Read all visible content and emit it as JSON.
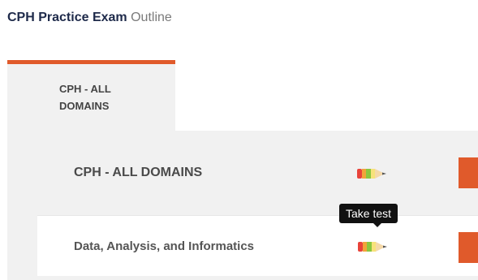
{
  "header": {
    "title_strong": "CPH Practice Exam",
    "title_light": "Outline"
  },
  "tabs": [
    {
      "label": "CPH - ALL DOMAINS",
      "active": true
    }
  ],
  "sections": [
    {
      "label": "CPH - ALL DOMAINS",
      "action_icon": "pencil-icon",
      "items": [
        {
          "label": "Data, Analysis, and Informatics",
          "action_icon": "pencil-icon"
        }
      ]
    }
  ],
  "tooltip": {
    "text": "Take test"
  },
  "colors": {
    "accent": "#e05a2b",
    "panel_bg": "#f1f1f1",
    "title": "#1e2a4a",
    "tooltip_bg": "#111111"
  }
}
